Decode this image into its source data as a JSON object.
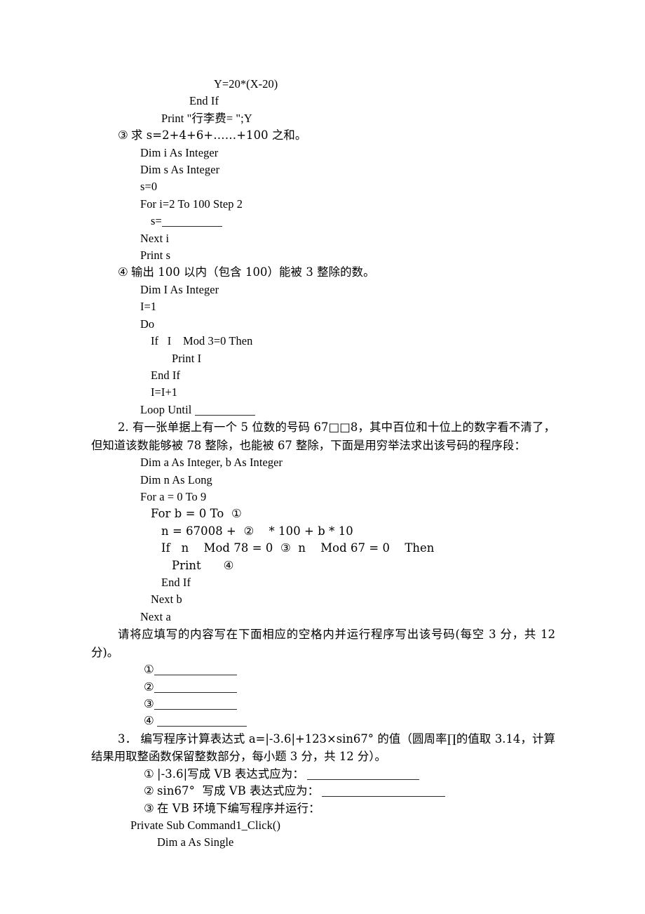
{
  "document": {
    "type": "exam-paper",
    "language": "zh-CN",
    "subject": "Visual Basic"
  },
  "code_block_1": {
    "lines": [
      "Y=20*(X-20)",
      "End If",
      "Print \"行李费= \";Y"
    ]
  },
  "item3": {
    "marker": "③",
    "prompt": "求 s=2+4+6+……+100 之和。",
    "code": [
      "Dim i As Integer",
      "Dim s As Integer",
      "s=0",
      "For i=2 To 100 Step 2"
    ],
    "blank_line_prefix": "s=",
    "code_after": [
      "Next i",
      "Print s"
    ]
  },
  "item4": {
    "marker": "④",
    "prompt": "输出 100 以内（包含 100）能被 3 整除的数。",
    "code": [
      "Dim I As Integer",
      "I=1",
      "Do",
      "If   I    Mod 3=0 Then",
      "Print I",
      "End If",
      "I=I+1"
    ],
    "loop_prefix": "Loop Until "
  },
  "question2": {
    "number": "2.",
    "text_line1": "有一张单据上有一个 5 位数的号码 67□□8，其中百位和十位上的数字看不清了，但",
    "text_line2": "知道该数能够被 78 整除，也能被 67 整除，下面是用穷举法求出该号码的程序段：",
    "code": [
      "Dim a As Integer, b As Integer",
      "Dim n As Long",
      "For a = 0 To 9",
      "For b = 0 To  ①",
      "n = 67008 +  ②    * 100 + b * 10",
      "If   n    Mod 78 = 0  ③  n    Mod 67 = 0    Then",
      "Print      ④",
      "End If",
      "Next b",
      "Next a"
    ],
    "instruction": "请将应填写的内容写在下面相应的空格内并运行程序写出该号码(每空 3 分，共 12 分)。",
    "answer_blanks": [
      "①",
      "②",
      "③",
      "④"
    ]
  },
  "question3": {
    "number": "3．",
    "text_line1": "编写程序计算表达式 a=|-3.6|+123×sin67°  的值（圆周率∏的值取 3.14，计算结果用",
    "text_line2": "取整函数保留整数部分，每小题 3 分，共 12 分）。",
    "subitems": [
      {
        "marker": "①",
        "label": "|-3.6|写成 VB 表达式应为："
      },
      {
        "marker": "②",
        "label": "sin67°  写成 VB 表达式应为："
      },
      {
        "marker": "③",
        "label": "在 VB 环境下编写程序并运行："
      }
    ],
    "code": [
      "Private Sub Command1_Click()",
      "Dim a As Single"
    ]
  }
}
